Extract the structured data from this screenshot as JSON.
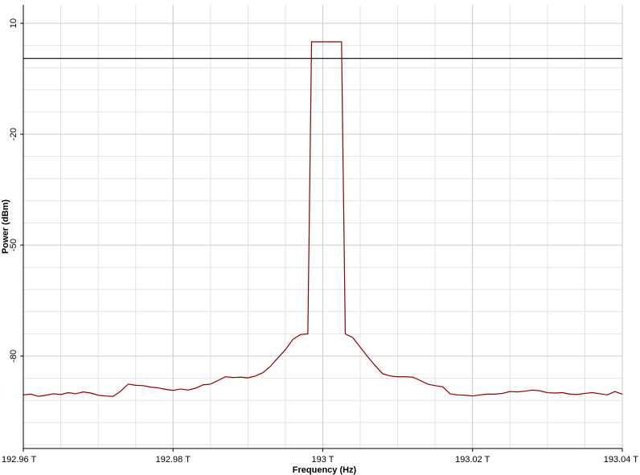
{
  "chart_data": {
    "type": "line",
    "title": "",
    "xlabel": "Frequency (Hz)",
    "ylabel": "Power (dBm)",
    "xlim": [
      192.96,
      193.04
    ],
    "ylim": [
      -105,
      15
    ],
    "grid": true,
    "x_ticks": [
      192.96,
      192.98,
      193.0,
      193.02,
      193.04
    ],
    "x_tick_labels": [
      "192.96 T",
      "192.98 T",
      "193 T",
      "193.02 T",
      "193.04 T"
    ],
    "y_ticks": [
      10,
      -20,
      -50,
      -80
    ],
    "y_tick_labels": [
      "10",
      "-20",
      "-50",
      "-80"
    ],
    "reference_line": {
      "y": 0.5,
      "color": "#000000"
    },
    "series": [
      {
        "color": "#8b0000",
        "x": [
          192.96,
          192.961,
          192.962,
          192.963,
          192.964,
          192.965,
          192.966,
          192.967,
          192.968,
          192.969,
          192.97,
          192.971,
          192.972,
          192.973,
          192.974,
          192.975,
          192.976,
          192.977,
          192.978,
          192.979,
          192.98,
          192.981,
          192.982,
          192.983,
          192.984,
          192.985,
          192.986,
          192.987,
          192.988,
          192.989,
          192.99,
          192.991,
          192.992,
          192.993,
          192.994,
          192.995,
          192.996,
          192.997,
          192.998,
          192.9985,
          193.0025,
          193.003,
          193.004,
          193.005,
          193.006,
          193.007,
          193.008,
          193.009,
          193.01,
          193.011,
          193.012,
          193.013,
          193.014,
          193.015,
          193.016,
          193.017,
          193.018,
          193.019,
          193.02,
          193.021,
          193.022,
          193.023,
          193.024,
          193.025,
          193.026,
          193.027,
          193.028,
          193.029,
          193.03,
          193.031,
          193.032,
          193.033,
          193.034,
          193.035,
          193.036,
          193.037,
          193.038,
          193.039,
          193.04
        ],
        "y": [
          -90.5,
          -90.3,
          -90.9,
          -90.6,
          -90.2,
          -90.4,
          -89.9,
          -90.2,
          -89.7,
          -90.0,
          -90.6,
          -90.8,
          -90.9,
          -89.5,
          -87.6,
          -87.9,
          -88.0,
          -88.4,
          -88.6,
          -89.0,
          -89.3,
          -88.9,
          -89.2,
          -88.7,
          -87.8,
          -87.6,
          -86.6,
          -85.6,
          -85.8,
          -85.7,
          -85.9,
          -85.4,
          -84.5,
          -82.8,
          -80.5,
          -78.3,
          -75.5,
          -74.2,
          -74.0,
          5.0,
          5.0,
          -74.0,
          -75.0,
          -77.6,
          -80.2,
          -82.6,
          -84.8,
          -85.4,
          -85.6,
          -85.6,
          -85.7,
          -86.6,
          -87.6,
          -88.0,
          -88.3,
          -90.2,
          -90.5,
          -90.6,
          -90.8,
          -90.5,
          -90.3,
          -90.3,
          -90.1,
          -89.6,
          -89.7,
          -89.5,
          -89.2,
          -89.4,
          -89.9,
          -90.0,
          -89.9,
          -90.3,
          -90.4,
          -90.1,
          -89.9,
          -90.2,
          -90.5,
          -89.6,
          -90.3
        ]
      }
    ]
  }
}
